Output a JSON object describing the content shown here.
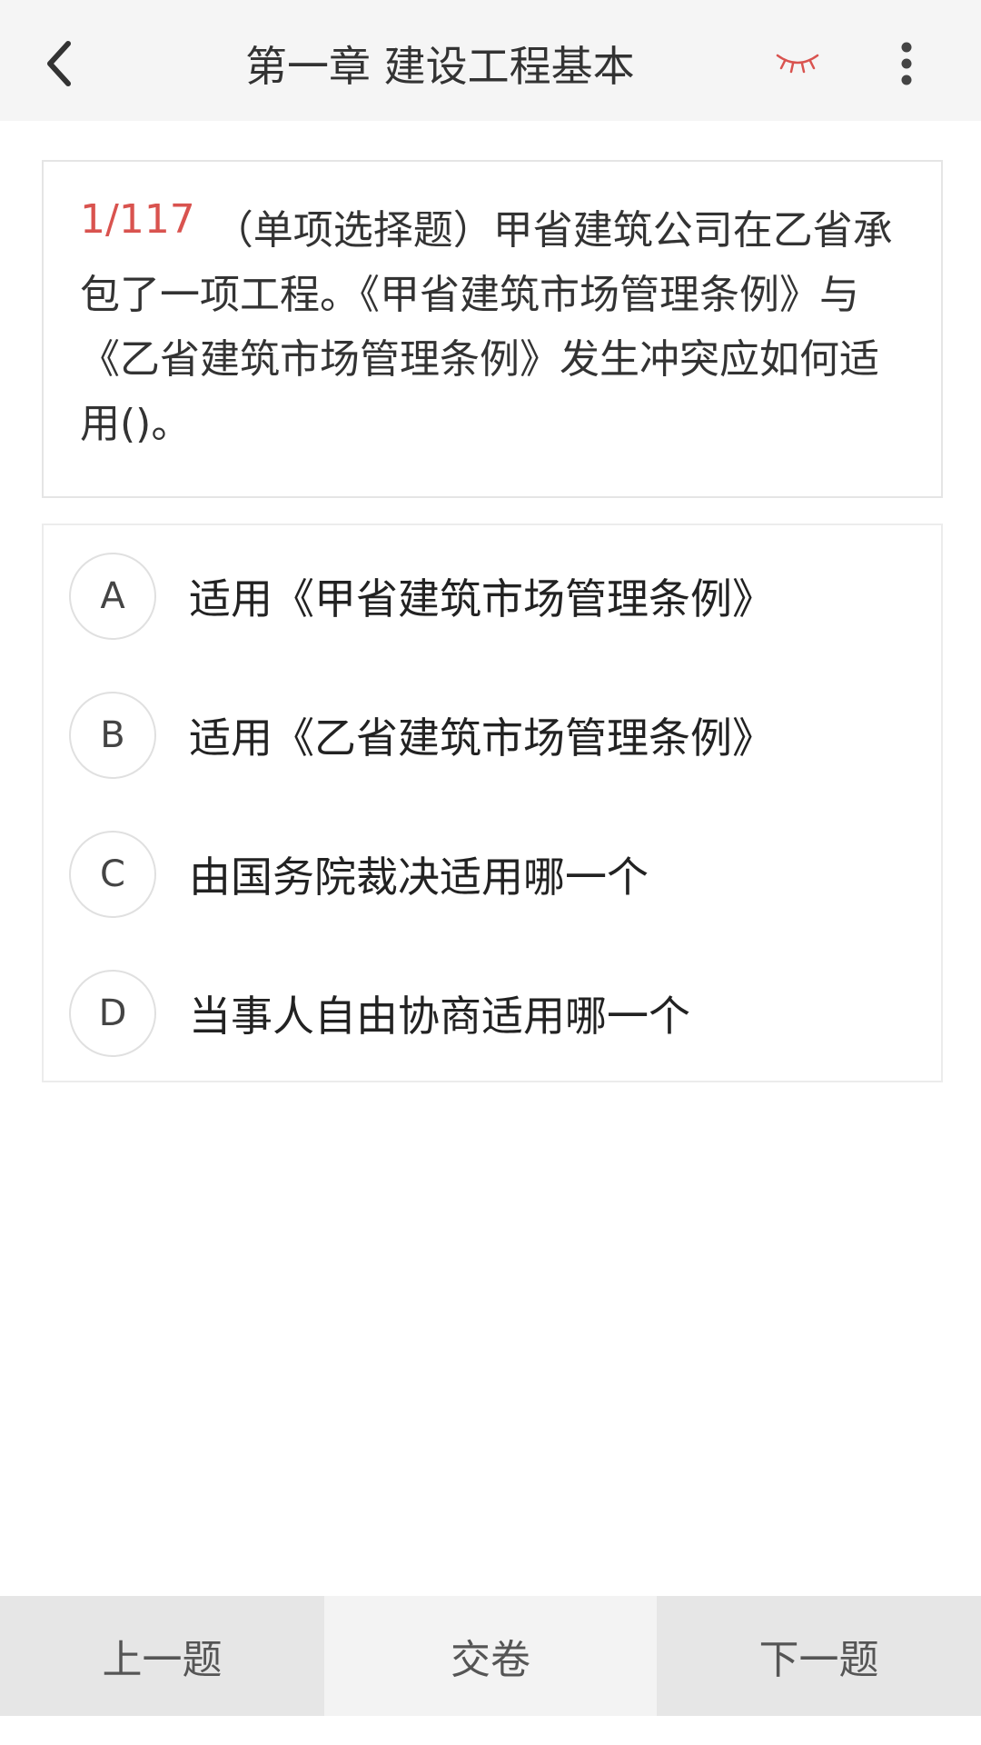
{
  "header": {
    "title": "第一章 建设工程基本",
    "accent_color": "#d9534f"
  },
  "icons": {
    "back": "chevron-left-icon",
    "eye": "closed-eye-icon",
    "more": "vertical-dots-icon"
  },
  "question": {
    "index": "1/117",
    "text": "（单项选择题）甲省建筑公司在乙省承包了一项工程。《甲省建筑市场管理条例》与《乙省建筑市场管理条例》发生冲突应如何适用()。"
  },
  "options": [
    {
      "letter": "A",
      "text": "适用《甲省建筑市场管理条例》"
    },
    {
      "letter": "B",
      "text": "适用《乙省建筑市场管理条例》"
    },
    {
      "letter": "C",
      "text": "由国务院裁决适用哪一个"
    },
    {
      "letter": "D",
      "text": "当事人自由协商适用哪一个"
    }
  ],
  "footer": {
    "prev_label": "上一题",
    "submit_label": "交卷",
    "next_label": "下一题"
  }
}
